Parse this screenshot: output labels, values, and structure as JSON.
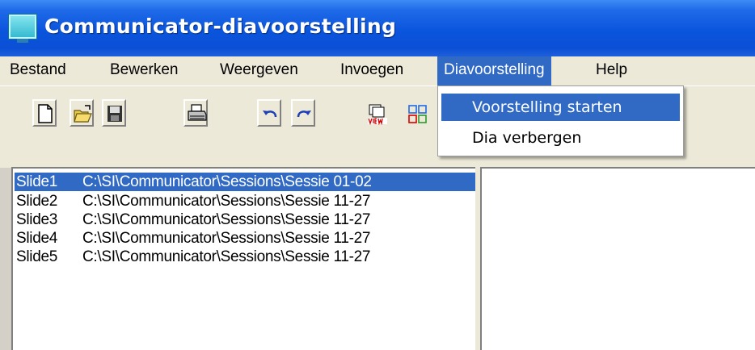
{
  "window": {
    "title": "Communicator-diavoorstelling"
  },
  "menubar": {
    "items": [
      {
        "id": "bestand",
        "label": "Bestand"
      },
      {
        "id": "bewerken",
        "label": "Bewerken"
      },
      {
        "id": "weergeven",
        "label": "Weergeven"
      },
      {
        "id": "invoegen",
        "label": "Invoegen"
      },
      {
        "id": "diavoorstelling",
        "label": "Diavoorstelling",
        "active": true
      },
      {
        "id": "help",
        "label": "Help"
      }
    ]
  },
  "dropdown": {
    "items": [
      {
        "label": "Voorstelling starten",
        "highlighted": true
      },
      {
        "label": "Dia verbergen",
        "highlighted": false
      }
    ]
  },
  "toolbar": {
    "buttons": [
      "new-icon",
      "open-icon",
      "save-icon",
      "print-icon",
      "undo-icon",
      "redo-icon",
      "view-icon",
      "grid-icon"
    ]
  },
  "slides": [
    {
      "name": "Slide1",
      "path": "C:\\SI\\Communicator\\Sessions\\Sessie 01-02",
      "selected": true
    },
    {
      "name": "Slide2",
      "path": "C:\\SI\\Communicator\\Sessions\\Sessie 11-27",
      "selected": false
    },
    {
      "name": "Slide3",
      "path": "C:\\SI\\Communicator\\Sessions\\Sessie 11-27",
      "selected": false
    },
    {
      "name": "Slide4",
      "path": "C:\\SI\\Communicator\\Sessions\\Sessie 11-27",
      "selected": false
    },
    {
      "name": "Slide5",
      "path": "C:\\SI\\Communicator\\Sessions\\Sessie 11-27",
      "selected": false
    }
  ],
  "colors": {
    "titlebar": "#0b4fd6",
    "selection": "#316ac5",
    "chrome": "#ece9d8"
  }
}
